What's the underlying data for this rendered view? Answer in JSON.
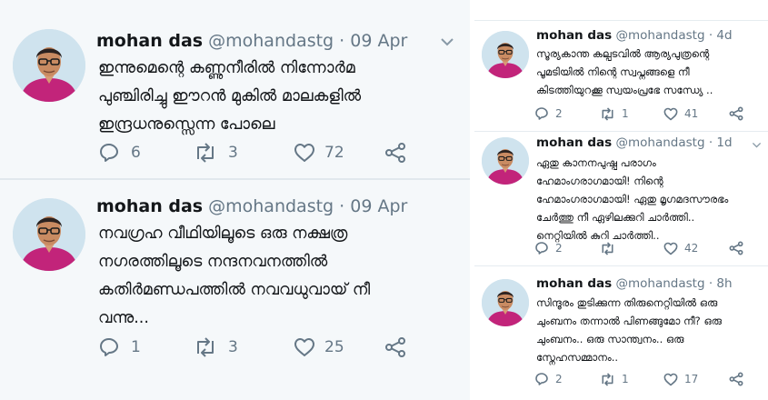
{
  "left_tweets": [
    {
      "name": "mohan das",
      "handle": "@mohandastg",
      "separator": "·",
      "time": "09 Apr",
      "lines": [
        "ഇന്നുമെന്റെ കണ്ണുനീരിൽ  നിന്നോർമ",
        "പുഞ്ചിരിച്ചു  ഈറൻ മുകിൽ മാലകളിൽ",
        "ഇന്ദ്രധനുസ്സെന്ന പോലെ"
      ],
      "replies": "6",
      "retweets": "3",
      "likes": "72"
    },
    {
      "name": "mohan das",
      "handle": "@mohandastg",
      "separator": "·",
      "time": "09 Apr",
      "lines": [
        "നവഗ്രഹ വീഥിയിലൂടെ  ഒരു നക്ഷത്ര",
        "നഗരത്തിലൂടെ  നന്ദനവനത്തിൽ",
        "കതിർമണ്ഡപത്തിൽ  നവവധുവായ് നീ",
        "വന്നു..."
      ],
      "replies": "1",
      "retweets": "3",
      "likes": "25"
    }
  ],
  "right_tweets": [
    {
      "name": "mohan das",
      "handle": "@mohandastg",
      "separator": "·",
      "time": "4d",
      "lines": [
        "സൂര്യകാന്ത കല്പടവിൽ  ആര്യപുത്രന്റെ",
        "പൂമടിയിൽ  നിന്റെ സ്വപ്നങ്ങളെ നീ",
        "കിടത്തിയുറക്കൂ  സ്വയംപ്രഭേ സന്ധ്യേ .."
      ],
      "replies": "2",
      "retweets": "1",
      "likes": "41"
    },
    {
      "name": "mohan das",
      "handle": "@mohandastg",
      "separator": "·",
      "time": "1d",
      "lines": [
        "ഏതു കാനനപുഷ്പ പരാഗം",
        "ഹേമാംഗരാഗമായി! നിന്റെ",
        "ഹേമാംഗരാഗമായി! ഏതു മൃഗമദസൗരഭം",
        "ചേർത്തു നീ ഏഴിലക്കുറി ചാർത്തി..",
        "നെറ്റിയിൽ കുറി ചാർത്തി.."
      ],
      "replies": "2",
      "retweets": "",
      "likes": "42"
    },
    {
      "name": "mohan das",
      "handle": "@mohandastg",
      "separator": "·",
      "time": "8h",
      "lines": [
        "സിന്ദൂരം തുടിക്കുന്ന തിരുനെറ്റിയിൽ  ഒരു",
        "ചുംബനം തന്നാൽ പിണങ്ങുമോ നീ? ഒരു",
        "ചുംബനം..  ഒരു സാന്ത്വനം..  ഒരു",
        "സ്നേഹസമ്മാനം.."
      ],
      "replies": "2",
      "retweets": "1",
      "likes": "17"
    }
  ],
  "icons": {
    "chevron": "chevron-down-icon",
    "reply": "reply-icon",
    "retweet": "retweet-icon",
    "like": "heart-icon",
    "share": "share-icon"
  },
  "colors": {
    "name": "#14171a",
    "meta": "#657786",
    "panel_bg": "#f5f8fa",
    "avatar_shirt": "#c2247a"
  }
}
